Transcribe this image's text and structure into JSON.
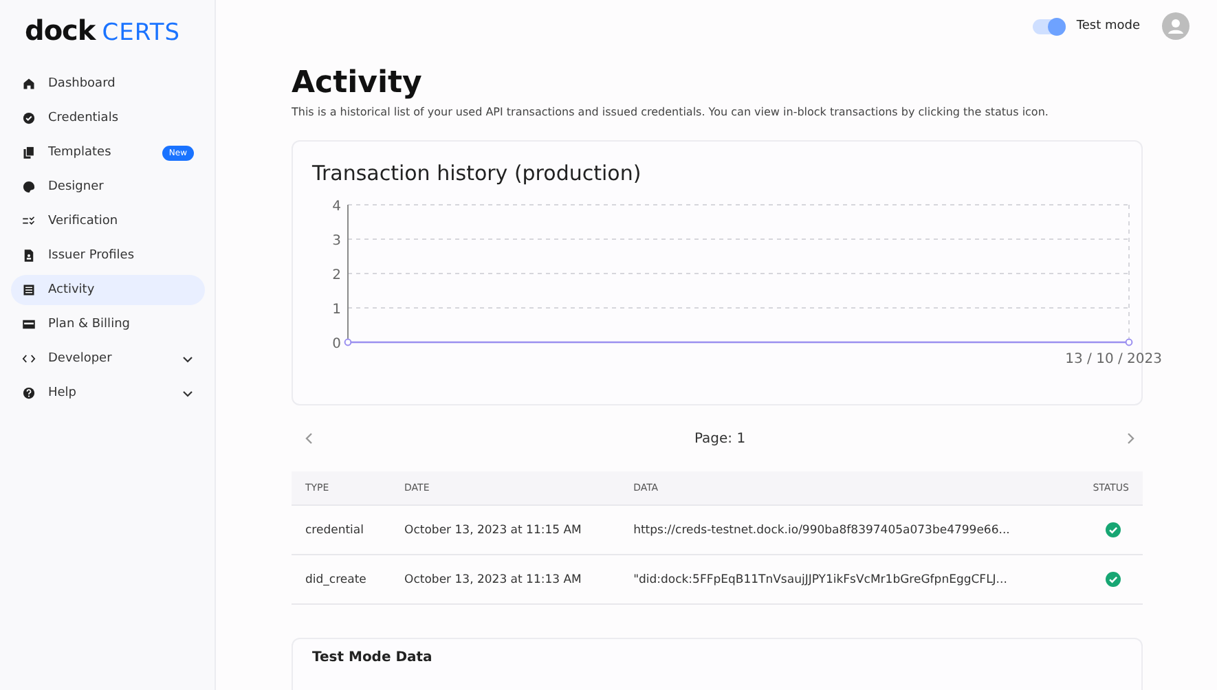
{
  "brand": {
    "name": "dock",
    "product": "CERTS"
  },
  "sidebar": {
    "items": [
      {
        "label": "Dashboard",
        "kind": "link",
        "selected": false
      },
      {
        "label": "Credentials",
        "kind": "link",
        "selected": false
      },
      {
        "label": "Templates",
        "kind": "link",
        "selected": false,
        "badge": "New"
      },
      {
        "label": "Designer",
        "kind": "link",
        "selected": false
      },
      {
        "label": "Verification",
        "kind": "link",
        "selected": false
      },
      {
        "label": "Issuer Profiles",
        "kind": "link",
        "selected": false
      },
      {
        "label": "Activity",
        "kind": "link",
        "selected": true
      },
      {
        "label": "Plan & Billing",
        "kind": "link",
        "selected": false
      },
      {
        "label": "Developer",
        "kind": "group",
        "selected": false,
        "expanded": false
      },
      {
        "label": "Help",
        "kind": "group",
        "selected": false,
        "expanded": false
      }
    ]
  },
  "header": {
    "test_mode": {
      "label": "Test mode",
      "on": true
    }
  },
  "page": {
    "title": "Activity",
    "description": "This is a historical list of your used API transactions and issued credentials. You can view in-block transactions by clicking the status icon."
  },
  "chart_card": {
    "title": "Transaction history (production)",
    "y_axis_labels": [
      "4",
      "3",
      "2",
      "1",
      "0"
    ],
    "date_label": "13 / 10 / 2023"
  },
  "pagination": {
    "label": "Page: 1"
  },
  "table": {
    "columns": [
      "TYPE",
      "DATE",
      "DATA",
      "STATUS"
    ],
    "rows": [
      {
        "type": "credential",
        "date": "October 13, 2023 at 11:15 AM",
        "data": "https://creds-testnet.dock.io/990ba8f8397405a073be4799e66...",
        "verified": true
      },
      {
        "type": "did_create",
        "date": "October 13, 2023 at 11:13 AM",
        "data": "\"did:dock:5FFpEqB11TnVsaujJJPY1ikFsVcMr1bGreGfpnEggCFLJ...",
        "verified": true
      }
    ]
  },
  "test_card": {
    "title": "Test Mode Data"
  }
}
